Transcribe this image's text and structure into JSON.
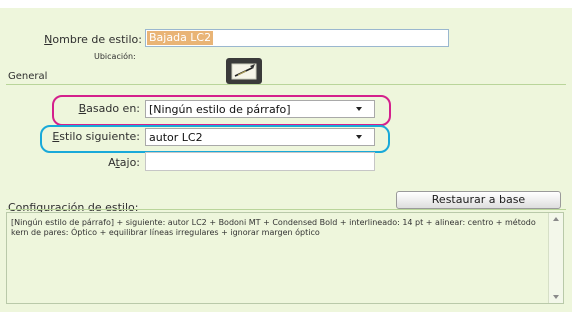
{
  "style_name": {
    "label_underline": "N",
    "label_rest": "ombre de estilo:",
    "value": "Bajada LC2"
  },
  "location": {
    "label": "Ubicación:"
  },
  "section_general": "General",
  "based_on": {
    "label_underline": "B",
    "label_rest": "asado en:",
    "value": "[Ningún estilo de párrafo]"
  },
  "next_style": {
    "label_underline": "E",
    "label_rest": "stilo siguiente:",
    "value": "autor LC2"
  },
  "shortcut": {
    "label_pre": "A",
    "label_underline": "t",
    "label_post": "ajo:",
    "value": ""
  },
  "style_settings": {
    "label": "Configuración de estilo:",
    "reset_button": "Restaurar a base",
    "description": "[Ningún estilo de párrafo] + siguiente: autor LC2 + Bodoni MT + Condensed Bold + interlineado: 14 pt + alinear: centro + método kern de pares: Óptico + equilibrar líneas irregulares + ignorar margen óptico"
  },
  "colors": {
    "panel_bg": "#eef6dc",
    "highlight_pink": "#d4208c",
    "highlight_cyan": "#19a9d9",
    "name_field_bg": "#e9c79c"
  },
  "icons": {
    "edit_icon": "pencil-notepad-icon"
  }
}
